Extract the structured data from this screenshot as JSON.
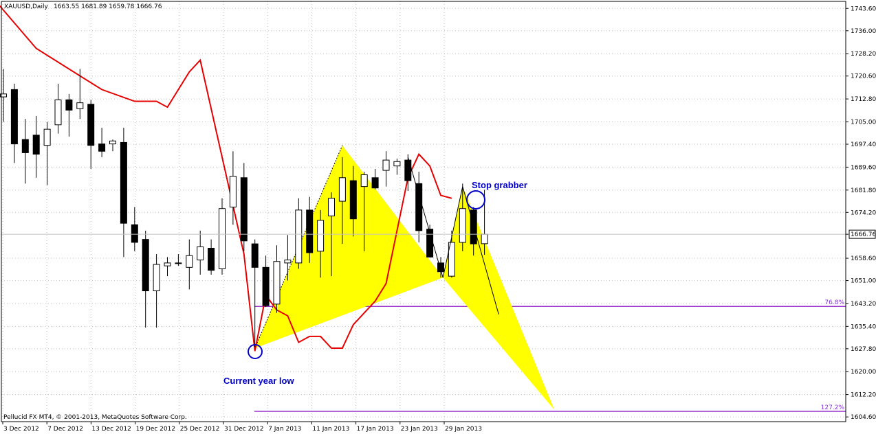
{
  "header": {
    "symbol": "XAUUSD,Daily",
    "ohlc": "1663.55 1681.89 1659.78 1666.76"
  },
  "footer": {
    "copyright": "Pellucid FX MT4, © 2001-2013, MetaQuotes Software Corp."
  },
  "current_price_label": "1666.76",
  "annotations": {
    "stop_grabber": "Stop grabber",
    "current_year_low": "Current year low"
  },
  "fib_levels": [
    {
      "label": "76.8%",
      "price": 1642.2
    },
    {
      "label": "127.2%",
      "price": 1606.5
    }
  ],
  "colors": {
    "up_candle": "#ffffff",
    "down_candle": "#000000",
    "ma_line": "#e60000",
    "pattern_fill": "#ffff00",
    "fib_line": "#9932cc",
    "annotation": "#0000c8",
    "grid": "#c0c0c0"
  },
  "chart_data": {
    "type": "candlestick",
    "y_ticks": [
      "1743.60",
      "1736.00",
      "1728.20",
      "1720.60",
      "1712.80",
      "1705.00",
      "1697.40",
      "1689.60",
      "1681.80",
      "1674.20",
      "1666.76",
      "1658.60",
      "1651.00",
      "1643.20",
      "1635.40",
      "1627.80",
      "1620.00",
      "1612.20",
      "1604.60"
    ],
    "x_ticks": [
      "3 Dec 2012",
      "7 Dec 2012",
      "13 Dec 2012",
      "19 Dec 2012",
      "25 Dec 2012",
      "31 Dec 2012",
      "7 Jan 2013",
      "11 Jan 2013",
      "17 Jan 2013",
      "23 Jan 2013",
      "29 Jan 2013"
    ],
    "ylim": [
      1603,
      1746
    ],
    "candles": [
      {
        "o": 1713.5,
        "h": 1723.0,
        "l": 1705.0,
        "c": 1714.5
      },
      {
        "o": 1716.0,
        "h": 1718.0,
        "l": 1691.0,
        "c": 1697.5
      },
      {
        "o": 1699.0,
        "h": 1706.0,
        "l": 1684.0,
        "c": 1694.5
      },
      {
        "o": 1700.5,
        "h": 1707.0,
        "l": 1686.0,
        "c": 1694.0
      },
      {
        "o": 1697.0,
        "h": 1705.0,
        "l": 1683.5,
        "c": 1702.5
      },
      {
        "o": 1704.0,
        "h": 1718.0,
        "l": 1701.0,
        "c": 1712.5
      },
      {
        "o": 1712.5,
        "h": 1714.5,
        "l": 1700.0,
        "c": 1709.0
      },
      {
        "o": 1709.5,
        "h": 1723.0,
        "l": 1706.0,
        "c": 1711.5
      },
      {
        "o": 1711.0,
        "h": 1712.5,
        "l": 1689.0,
        "c": 1697.0
      },
      {
        "o": 1697.5,
        "h": 1703.0,
        "l": 1693.0,
        "c": 1695.0
      },
      {
        "o": 1697.5,
        "h": 1699.0,
        "l": 1695.0,
        "c": 1698.5
      },
      {
        "o": 1698.0,
        "h": 1703.0,
        "l": 1659.0,
        "c": 1670.5
      },
      {
        "o": 1670.0,
        "h": 1676.0,
        "l": 1661.0,
        "c": 1664.0
      },
      {
        "o": 1665.0,
        "h": 1668.0,
        "l": 1635.0,
        "c": 1647.5
      },
      {
        "o": 1647.5,
        "h": 1660.0,
        "l": 1635.0,
        "c": 1656.5
      },
      {
        "o": 1656.0,
        "h": 1659.0,
        "l": 1652.5,
        "c": 1657.0
      },
      {
        "o": 1657.0,
        "h": 1660.0,
        "l": 1656.0,
        "c": 1657.0
      },
      {
        "o": 1655.5,
        "h": 1665.0,
        "l": 1648.0,
        "c": 1659.5
      },
      {
        "o": 1658.0,
        "h": 1668.0,
        "l": 1653.0,
        "c": 1662.5
      },
      {
        "o": 1662.0,
        "h": 1665.0,
        "l": 1653.0,
        "c": 1654.5
      },
      {
        "o": 1655.0,
        "h": 1679.0,
        "l": 1653.0,
        "c": 1675.5
      },
      {
        "o": 1676.0,
        "h": 1695.0,
        "l": 1670.0,
        "c": 1686.5
      },
      {
        "o": 1686.0,
        "h": 1691.0,
        "l": 1661.0,
        "c": 1664.5
      },
      {
        "o": 1663.5,
        "h": 1665.0,
        "l": 1628.5,
        "c": 1655.5
      },
      {
        "o": 1655.5,
        "h": 1659.5,
        "l": 1642.0,
        "c": 1642.5
      },
      {
        "o": 1643.0,
        "h": 1663.0,
        "l": 1640.0,
        "c": 1657.5
      },
      {
        "o": 1657.0,
        "h": 1666.5,
        "l": 1651.0,
        "c": 1658.0
      },
      {
        "o": 1657.0,
        "h": 1679.0,
        "l": 1655.0,
        "c": 1675.0
      },
      {
        "o": 1675.0,
        "h": 1679.5,
        "l": 1657.0,
        "c": 1660.5
      },
      {
        "o": 1661.0,
        "h": 1675.0,
        "l": 1652.0,
        "c": 1671.5
      },
      {
        "o": 1673.0,
        "h": 1681.0,
        "l": 1652.5,
        "c": 1679.0
      },
      {
        "o": 1678.0,
        "h": 1693.0,
        "l": 1663.5,
        "c": 1686.0
      },
      {
        "o": 1685.0,
        "h": 1690.0,
        "l": 1666.0,
        "c": 1672.0
      },
      {
        "o": 1683.0,
        "h": 1688.0,
        "l": 1661.0,
        "c": 1687.0
      },
      {
        "o": 1686.0,
        "h": 1689.0,
        "l": 1682.0,
        "c": 1682.5
      },
      {
        "o": 1688.5,
        "h": 1695.0,
        "l": 1683.0,
        "c": 1692.0
      },
      {
        "o": 1690.0,
        "h": 1692.5,
        "l": 1687.0,
        "c": 1691.5
      },
      {
        "o": 1692.0,
        "h": 1694.0,
        "l": 1681.5,
        "c": 1685.0
      },
      {
        "o": 1684.0,
        "h": 1688.0,
        "l": 1664.0,
        "c": 1668.0
      },
      {
        "o": 1668.5,
        "h": 1670.0,
        "l": 1659.0,
        "c": 1659.0
      },
      {
        "o": 1657.0,
        "h": 1659.0,
        "l": 1652.0,
        "c": 1654.0
      },
      {
        "o": 1652.5,
        "h": 1668.0,
        "l": 1652.0,
        "c": 1664.0
      },
      {
        "o": 1664.0,
        "h": 1684.0,
        "l": 1661.0,
        "c": 1675.5
      },
      {
        "o": 1675.0,
        "h": 1676.0,
        "l": 1659.5,
        "c": 1663.5
      },
      {
        "o": 1663.55,
        "h": 1681.89,
        "l": 1659.78,
        "c": 1666.76
      }
    ],
    "ma_line": [
      [
        -3,
        1756
      ],
      [
        3,
        1730
      ],
      [
        9,
        1716
      ],
      [
        12,
        1712
      ],
      [
        14,
        1712
      ],
      [
        15,
        1710
      ],
      [
        17,
        1722
      ],
      [
        18,
        1726
      ],
      [
        22,
        1660
      ],
      [
        23,
        1627
      ],
      [
        24,
        1646
      ],
      [
        25,
        1641
      ],
      [
        26,
        1639
      ],
      [
        27,
        1630
      ],
      [
        28,
        1632
      ],
      [
        29,
        1632
      ],
      [
        30,
        1628
      ],
      [
        31,
        1628
      ],
      [
        32,
        1636
      ],
      [
        33,
        1640
      ],
      [
        34,
        1644
      ],
      [
        35,
        1650
      ],
      [
        36,
        1668
      ],
      [
        37,
        1686
      ],
      [
        38,
        1694
      ],
      [
        39,
        1690
      ],
      [
        40,
        1680
      ],
      [
        41,
        1679
      ]
    ],
    "xabcd_1": [
      [
        23.0,
        1628.0
      ],
      [
        31.0,
        1697.0
      ],
      [
        40.2,
        1652.0
      ],
      [
        30.5,
        1653.0
      ],
      [
        50.4,
        1607.0
      ]
    ],
    "xabcd_2": [
      [
        23.0,
        1628.0
      ],
      [
        31.0,
        1697.0
      ],
      [
        40.2,
        1652.0
      ],
      [
        30.5,
        1653.0
      ],
      [
        50.4,
        1607.0
      ]
    ],
    "pattern_lines": [
      [
        [
          23.0,
          1628.0
        ],
        [
          31.0,
          1697.0
        ],
        [
          40.2,
          1652.0
        ],
        [
          50.4,
          1607.0
        ]
      ],
      [
        [
          40.2,
          1652.0
        ],
        [
          42.0,
          1683.0
        ],
        [
          45.5,
          1639.0
        ]
      ]
    ]
  }
}
